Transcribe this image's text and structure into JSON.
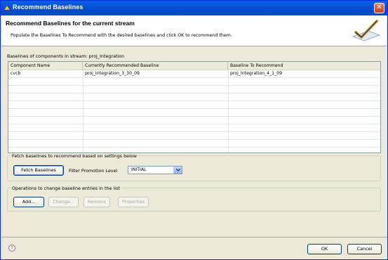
{
  "window": {
    "title": "Recommend Baselines",
    "close_glyph": "✕"
  },
  "header": {
    "title": "Recommend Baselines for the current stream",
    "description": "Populate the Baselines To Recommend with the desired baselines and click OK to recommend them.",
    "icon": "wizard-checkmark-icon"
  },
  "table_section": {
    "label": "Baselines of components in stream: proj_Integration"
  },
  "table": {
    "columns": [
      "Component Name",
      "Currently Recommended Baseline",
      "Baseline To Recommend"
    ],
    "rows": [
      [
        "cvcb",
        "proj_Integration_3_30_09",
        "proj_Integration_4_1_09"
      ]
    ]
  },
  "fetch_group": {
    "label": "Fetch baselines to recommend based on settings below",
    "fetch_button": "Fetch Baselines",
    "filter_label": "Filter Promotion Level",
    "filter_value": "INITIAL"
  },
  "ops_group": {
    "label": "Operations to change baseline entries in the list",
    "add": "Add...",
    "change": "Change...",
    "remove": "Remove",
    "properties": "Properties"
  },
  "footer": {
    "help_glyph": "?",
    "ok": "OK",
    "cancel": "Cancel"
  },
  "colors": {
    "titlebar": "#0855dd",
    "dialog_bg": "#ece9d8",
    "table_border": "#7f9db9"
  }
}
